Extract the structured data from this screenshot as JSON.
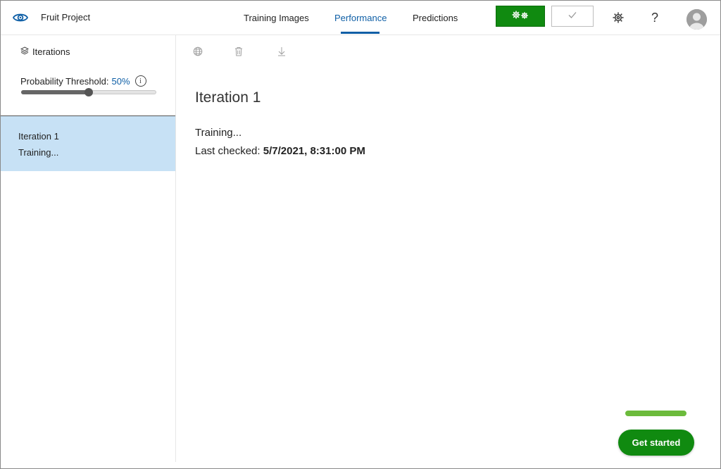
{
  "header": {
    "project_name": "Fruit Project",
    "tabs": [
      {
        "label": "Training Images",
        "active": false
      },
      {
        "label": "Performance",
        "active": true
      },
      {
        "label": "Predictions",
        "active": false
      }
    ],
    "help_label": "?"
  },
  "sidebar": {
    "iterations_label": "Iterations",
    "threshold_label": "Probability Threshold:",
    "threshold_value": "50%",
    "threshold_fraction": 0.5,
    "info_glyph": "i",
    "items": [
      {
        "name": "Iteration 1",
        "status": "Training...",
        "selected": true
      }
    ]
  },
  "main": {
    "title": "Iteration 1",
    "status": "Training...",
    "last_checked_label": "Last checked:",
    "last_checked_value": "5/7/2021, 8:31:00 PM"
  },
  "footer": {
    "get_started_label": "Get started"
  },
  "colors": {
    "accent": "#0f5fa6",
    "train_green": "#108a10",
    "selected_bg": "#c7e1f5",
    "progress_green": "#6cbb3c"
  }
}
